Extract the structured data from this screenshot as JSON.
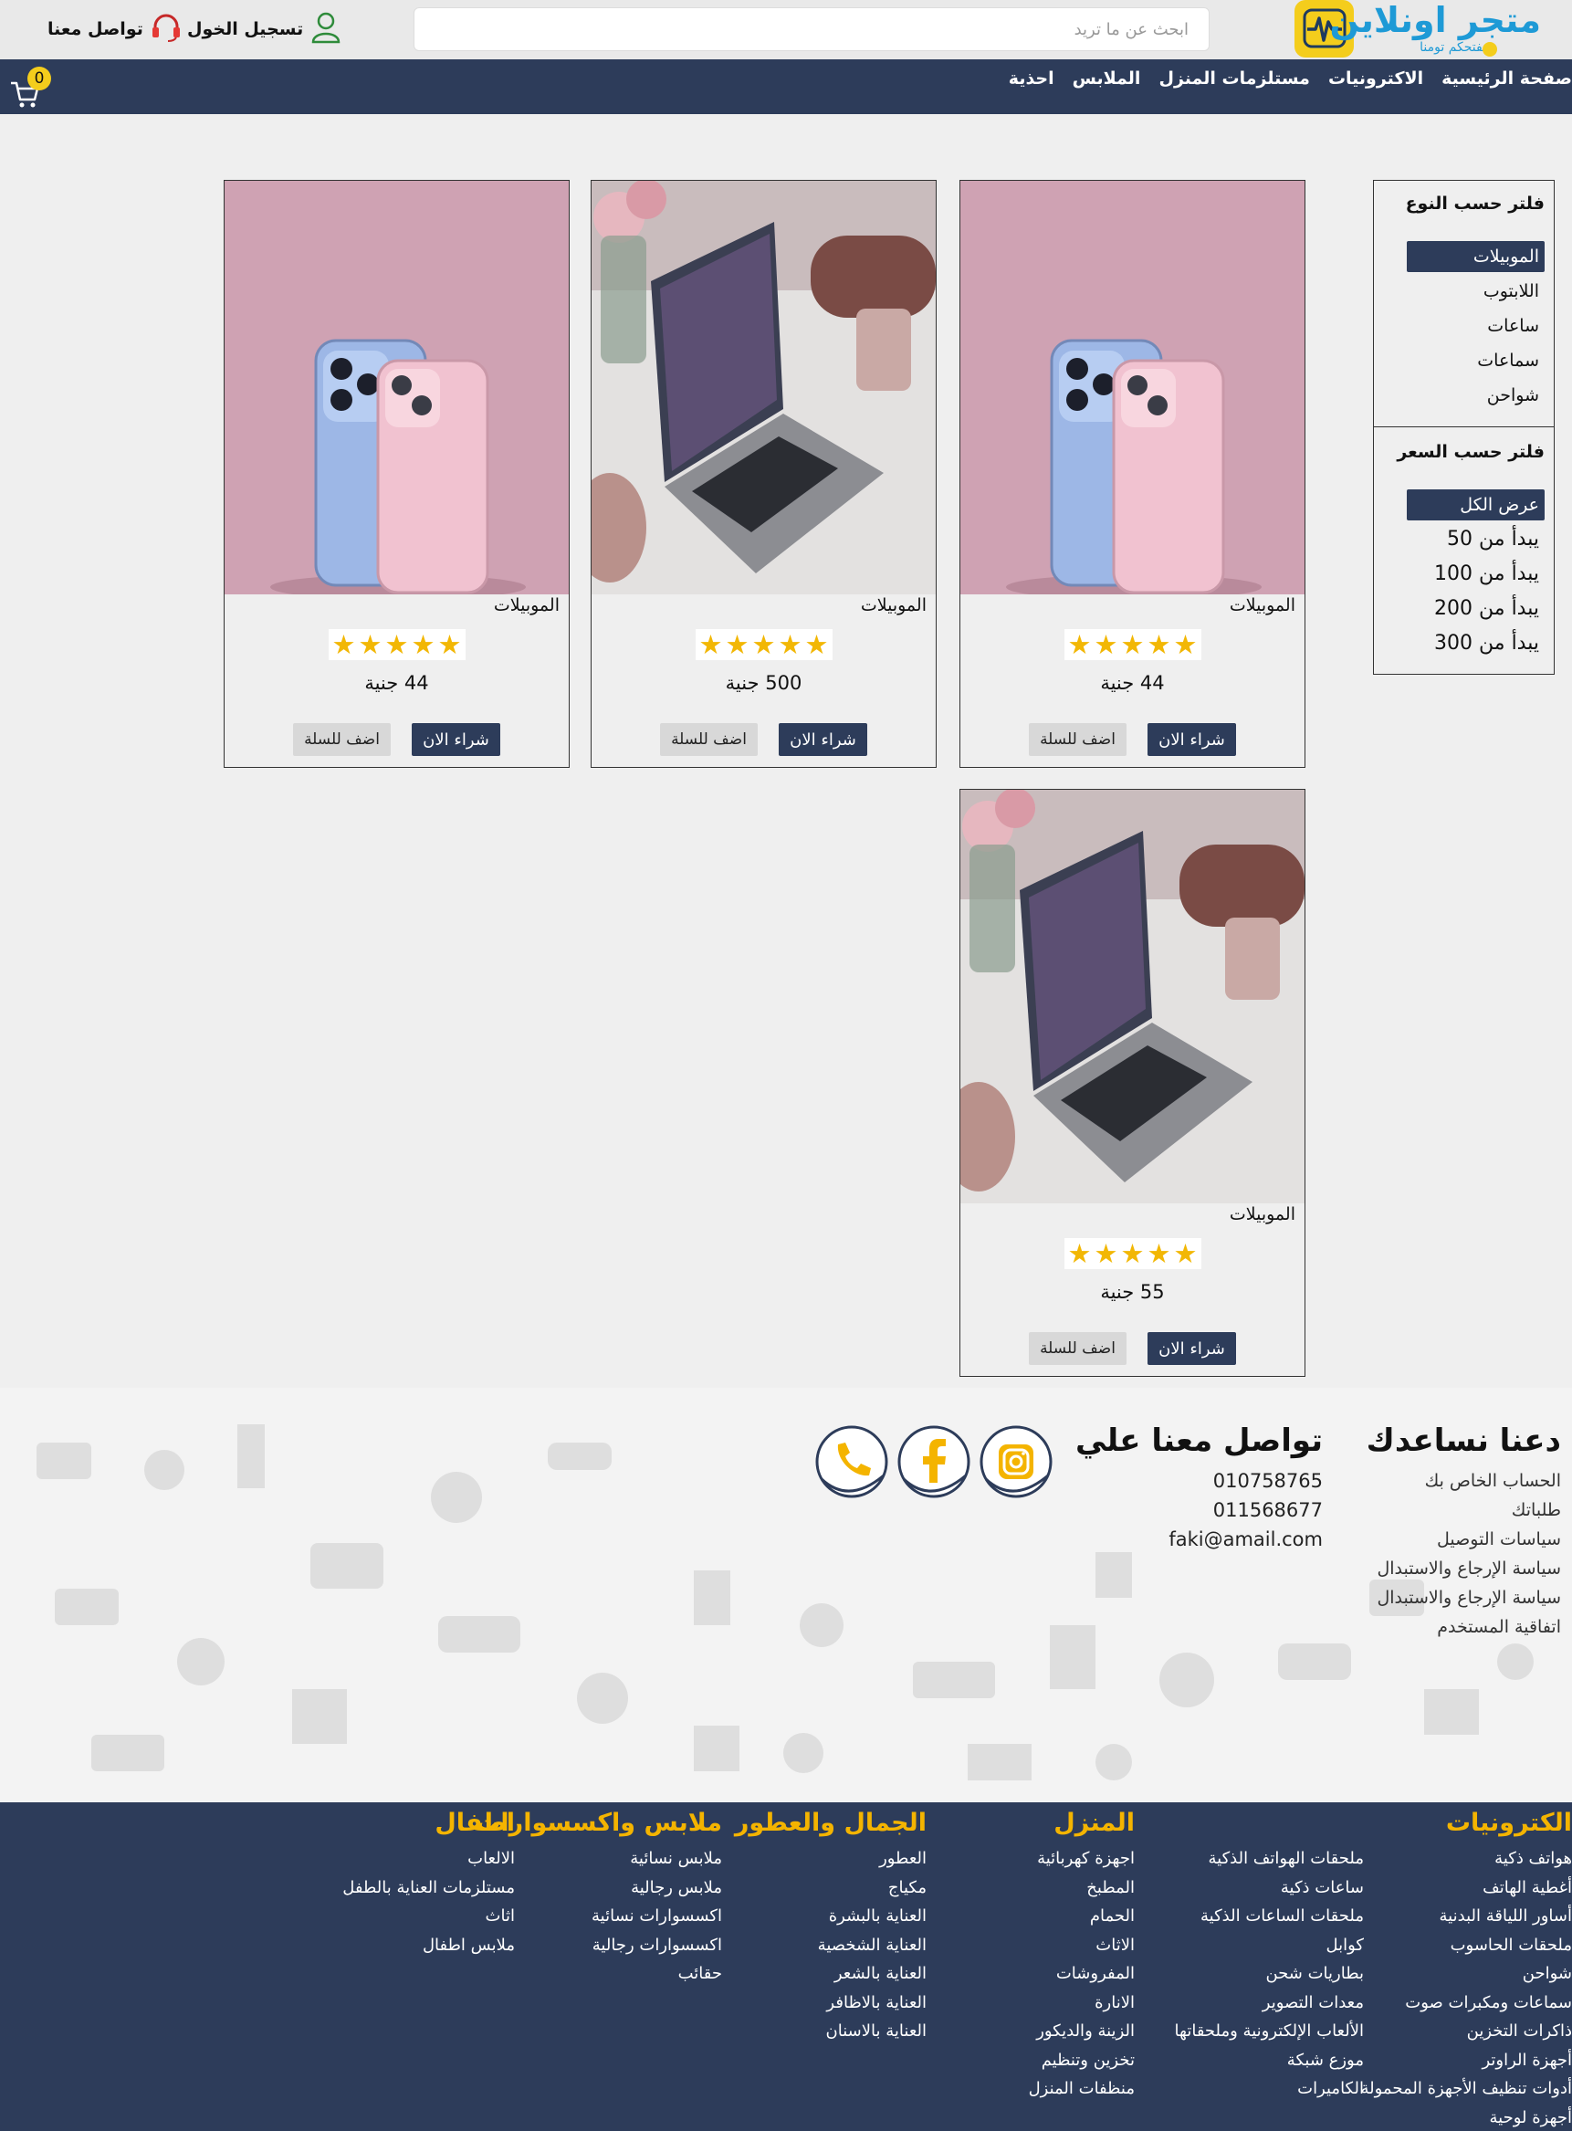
{
  "header": {
    "logo_title": "متجر اونلاين",
    "logo_tagline": "نفتحكم تومنا",
    "search_placeholder": "ابحث عن ما تريد",
    "login_label": "تسجيل الخول",
    "contact_label": "تواصل معنا"
  },
  "nav": {
    "items": [
      "صفحة الرئيسية",
      "الاكترونيات",
      "مستلزمات المنزل",
      "الملابس",
      "احذية"
    ],
    "cart_count": "0"
  },
  "filters": {
    "type_title": "فلتر حسب النوع",
    "types": [
      "الموبيلات",
      "اللابتوب",
      "ساعات",
      "سماعات",
      "شواحن"
    ],
    "types_active": 0,
    "price_title": "فلتر حسب السعر",
    "prices": [
      "عرض الكل",
      "يبدأ من 50",
      "يبدأ من 100",
      "يبدأ من 200",
      "يبدأ من 300"
    ],
    "prices_active": 0
  },
  "products": [
    {
      "category": "الموبيلات",
      "price": "44 جنية",
      "image": "phones",
      "rating": 5,
      "buy_label": "شراء الان",
      "add_label": "اضف للسلة"
    },
    {
      "category": "الموبيلات",
      "price": "500 جنية",
      "image": "laptop",
      "rating": 5,
      "buy_label": "شراء الان",
      "add_label": "اضف للسلة"
    },
    {
      "category": "الموبيلات",
      "price": "44 جنية",
      "image": "phones",
      "rating": 5,
      "buy_label": "شراء الان",
      "add_label": "اضف للسلة"
    },
    {
      "category": "الموبيلات",
      "price": "55 جنية",
      "image": "laptop",
      "rating": 5,
      "buy_label": "شراء الان",
      "add_label": "اضف للسلة"
    }
  ],
  "footer": {
    "help_title": "دعنا نساعدك",
    "help_links": [
      "الحساب الخاص بك",
      "طلباتك",
      "سياسات التوصيل",
      "سياسة الإرجاع والاستبدال",
      "سياسة الإرجاع والاستبدال",
      "اتفاقية المستخدم"
    ],
    "contact_title": "تواصل معنا علي",
    "contact_lines": [
      "010758765",
      "011568677",
      "faki@amail.com"
    ],
    "socials": [
      "instagram-icon",
      "facebook-icon",
      "phone-icon"
    ]
  },
  "categories": [
    {
      "title": "الكترونيات",
      "items": [
        "هواتف ذكية",
        "أغطية الهاتف",
        "أساور اللياقة البدنية",
        "ملحقات الحاسوب",
        "شواحن",
        "سماعات ومكبرات صوت",
        "ذاكرات التخزين",
        "أجهزة الراوتر",
        "أدوات تنظيف الأجهزة المحمولة",
        "أجهزة لوحية"
      ]
    },
    {
      "title": "",
      "items": [
        "ملحقات الهواتف الذكية",
        "ساعات ذكية",
        "ملحقات الساعات الذكية",
        "كوابل",
        "بطاريات شحن",
        "معدات التصوير",
        "الألعاب الإلكترونية وملحقاتها",
        "موزع شبكة",
        "الكاميرات"
      ]
    },
    {
      "title": "المنزل",
      "items": [
        "اجهزة كهربائية",
        "المطبخ",
        "الحمام",
        "الاثاث",
        "المفروشات",
        "الانارة",
        "الزينة والديكور",
        "تخزين وتنظيم",
        "منظفات المنزل"
      ]
    },
    {
      "title": "الجمال والعطور",
      "items": [
        "العطور",
        "مكياج",
        "العناية بالبشرة",
        "العناية الشخصية",
        "العناية بالشعر",
        "العناية بالاظافر",
        "العناية بالاسنان"
      ]
    },
    {
      "title": "ملابس واكسسوارات",
      "items": [
        "ملابس نسائية",
        "ملابس رجالية",
        "اكسسوارات نسائية",
        "اكسسوارات رجالية",
        "حقائب"
      ]
    },
    {
      "title": "اطفال",
      "items": [
        "الالعاب",
        "مستلزمات العناية بالطفل",
        "اثاث",
        "ملابس اطفال"
      ]
    }
  ],
  "colors": {
    "navy": "#2d3c5a",
    "accent_yellow": "#f4b400",
    "logo_blue": "#1e9ad6",
    "page_bg": "#efefef"
  }
}
